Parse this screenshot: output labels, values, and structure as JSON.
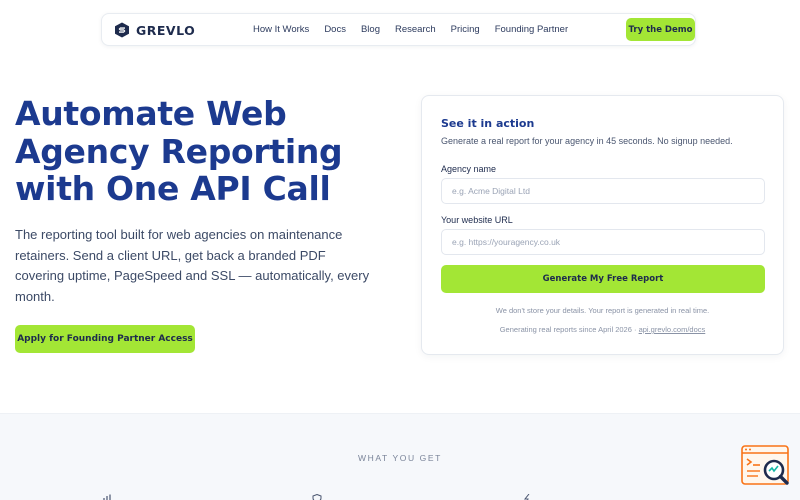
{
  "brand": {
    "name": "GREVLO",
    "logo_icon": "grevlo-s-logo-icon"
  },
  "nav": {
    "links": [
      "How It Works",
      "Docs",
      "Blog",
      "Research",
      "Pricing",
      "Founding Partner"
    ],
    "cta_label": "Try the Demo"
  },
  "hero": {
    "title": "Automate Web Agency Reporting with One API Call",
    "subtitle": "The reporting tool built for web agencies on maintenance retainers. Send a client URL, get back a branded PDF covering uptime, PageSpeed and SSL — automatically, every month.",
    "cta_label": "Apply for Founding Partner Access"
  },
  "demo_card": {
    "title": "See it in action",
    "subtitle": "Generate a real report for your agency in 45 seconds. No signup needed.",
    "agency_label": "Agency name",
    "agency_placeholder": "e.g. Acme Digital Ltd",
    "url_label": "Your website URL",
    "url_placeholder": "e.g. https://youragency.co.uk",
    "button_label": "Generate My Free Report",
    "privacy_note": "We don't store your details. Your report is generated in real time.",
    "since_note": "Generating real reports since April 2026 ·",
    "docs_link": "api.grevlo.com/docs"
  },
  "features": {
    "eyebrow": "WHAT YOU GET"
  },
  "colors": {
    "accent": "#a3e635",
    "heading": "#1c3a8f",
    "text": "#3c4a66"
  },
  "widget": {
    "icon": "report-search-widget-icon"
  }
}
